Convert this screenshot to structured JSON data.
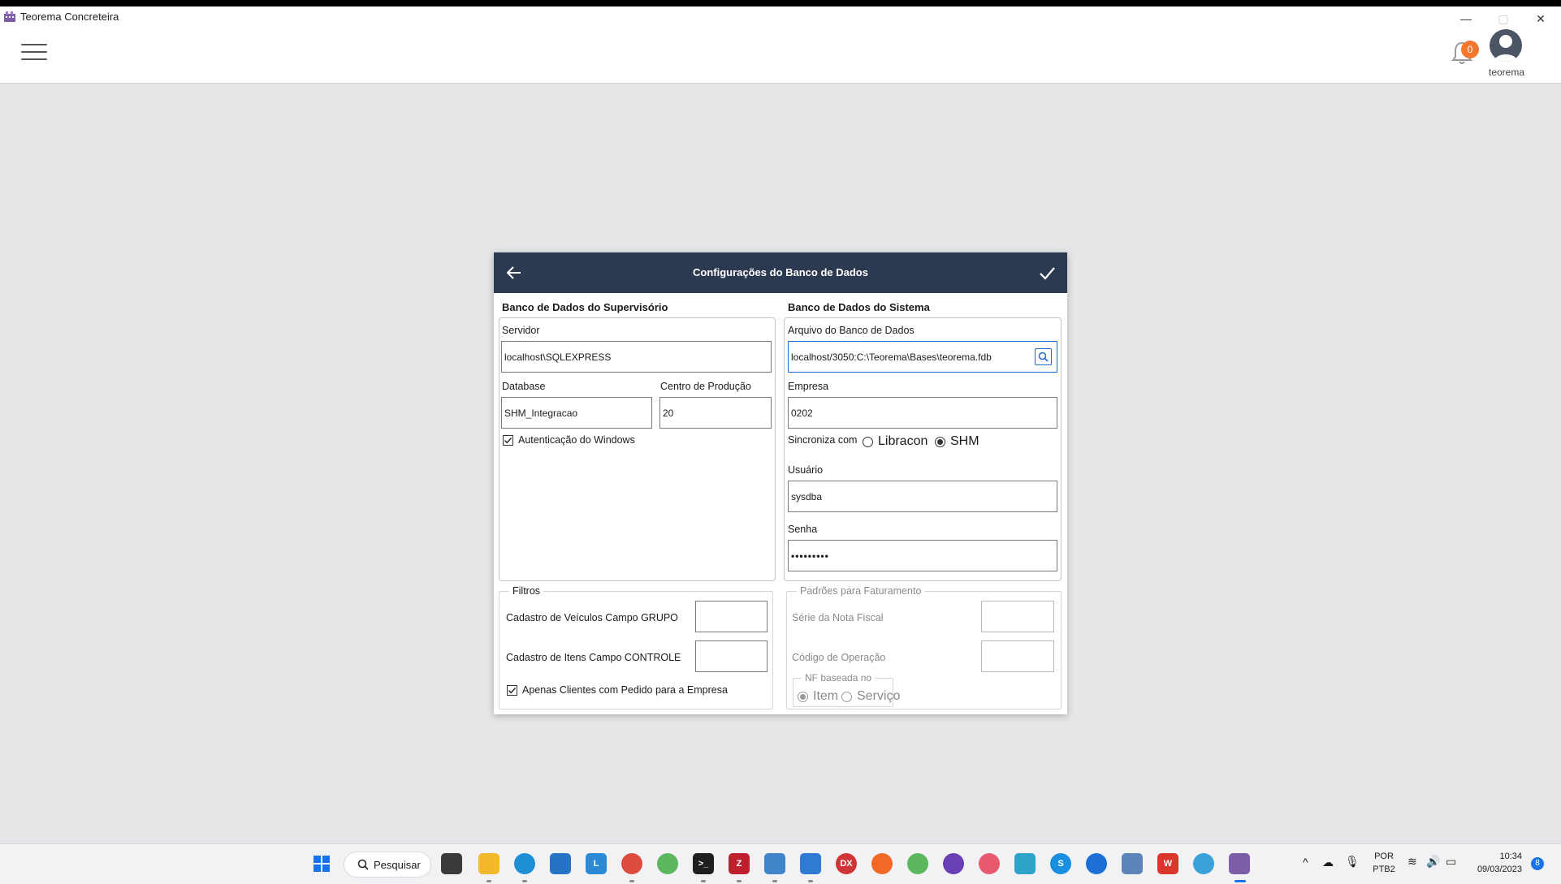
{
  "window": {
    "title": "Teorema Concreteira",
    "min_icon": "minimize-icon",
    "max_icon": "maximize-icon",
    "close_icon": "close-icon"
  },
  "header": {
    "menu_icon": "hamburger-icon",
    "notification_count": "0",
    "user": "teorema"
  },
  "dialog": {
    "title": "Configurações do Banco de Dados",
    "supervisorio": {
      "title": "Banco de Dados do Supervisório",
      "servidor_label": "Servidor",
      "servidor_value": "localhost\\SQLEXPRESS",
      "database_label": "Database",
      "database_value": "SHM_Integracao",
      "centro_label": "Centro de Produção",
      "centro_value": "20",
      "auth_label": "Autenticação do Windows"
    },
    "sistema": {
      "title": "Banco de Dados do Sistema",
      "arquivo_label": "Arquivo do Banco de Dados",
      "arquivo_value": "localhost/3050:C:\\Teorema\\Bases\\teorema.fdb",
      "empresa_label": "Empresa",
      "empresa_value": "0202",
      "sincroniza_label": "Sincroniza com",
      "opt_libracon": "Libracon",
      "opt_shm": "SHM",
      "usuario_label": "Usuário",
      "usuario_value": "sysdba",
      "senha_label": "Senha",
      "senha_value": "•••••••••"
    },
    "filtros": {
      "title": "Filtros",
      "veiculos_label": "Cadastro de Veículos Campo GRUPO",
      "veiculos_value": "",
      "itens_label": "Cadastro de Itens Campo CONTROLE",
      "itens_value": "",
      "apenas_label": "Apenas Clientes com Pedido para a Empresa"
    },
    "faturamento": {
      "title": "Padrões para Faturamento",
      "serie_label": "Série da Nota Fiscal",
      "serie_value": "",
      "codigo_label": "Código de Operação",
      "codigo_value": "",
      "nf_title": "NF baseada no",
      "opt_item": "Item",
      "opt_servico": "Serviço"
    }
  },
  "taskbar": {
    "search_label": "Pesquisar",
    "apps": [
      "windows-start-icon",
      "task-view-icon",
      "file-explorer-icon",
      "edge-icon",
      "store-icon",
      "l-app-icon",
      "chrome-icon",
      "network-app-icon",
      "terminal-icon",
      "filezilla-icon",
      "remote-desktop-icon",
      "notepad-icon",
      "devexpress-icon",
      "pencil-app-icon",
      "network-app-2-icon",
      "globe-icon",
      "chat-app-icon",
      "snipping-icon",
      "skype-icon",
      "maps-icon",
      "browser-app-icon",
      "wps-icon",
      "world-icon",
      "teorema-app-icon"
    ],
    "lang_top": "POR",
    "lang_bottom": "PTB2",
    "time": "10:34",
    "date": "09/03/2023",
    "notif_count": "8"
  }
}
